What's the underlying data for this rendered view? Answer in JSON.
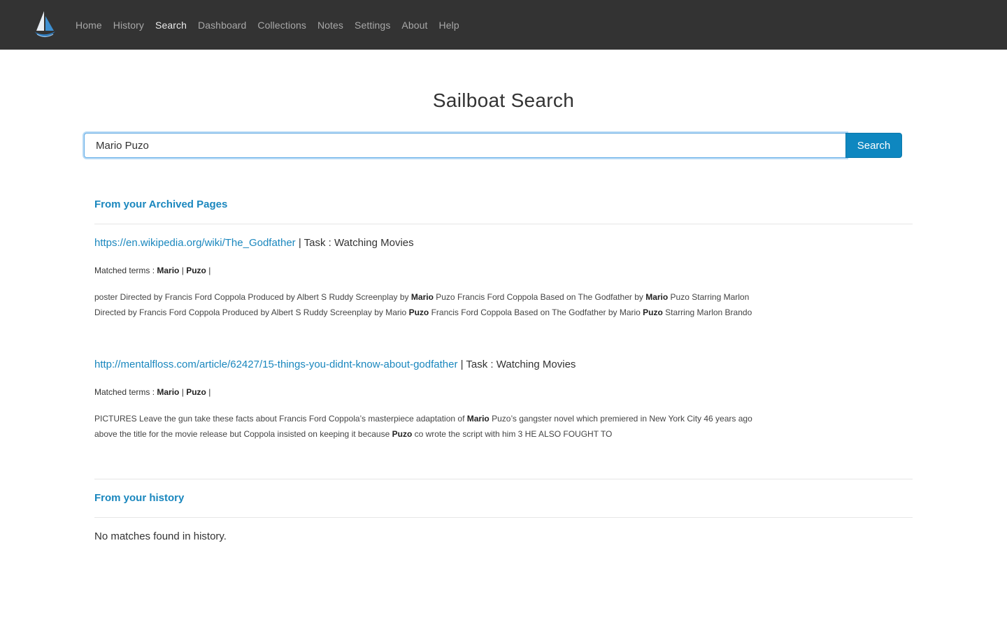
{
  "navbar": {
    "logo_icon": "sailboat-logo-icon",
    "items": [
      {
        "label": "Home",
        "active": false
      },
      {
        "label": "History",
        "active": false
      },
      {
        "label": "Search",
        "active": true
      },
      {
        "label": "Dashboard",
        "active": false
      },
      {
        "label": "Collections",
        "active": false
      },
      {
        "label": "Notes",
        "active": false
      },
      {
        "label": "Settings",
        "active": false
      },
      {
        "label": "About",
        "active": false
      },
      {
        "label": "Help",
        "active": false
      }
    ]
  },
  "page": {
    "title": "Sailboat Search"
  },
  "search": {
    "value": "Mario Puzo",
    "button_label": "Search"
  },
  "archived": {
    "heading": "From your Archived Pages",
    "matched_prefix": "Matched terms : ",
    "task_prefix": " | Task : ",
    "results": [
      {
        "url": "https://en.wikipedia.org/wiki/The_Godfather",
        "task": "Watching Movies",
        "terms": [
          "Mario",
          "Puzo"
        ],
        "snippet_lines": [
          [
            {
              "t": "poster Directed by Francis Ford Coppola Produced by Albert S Ruddy Screenplay by ",
              "b": false
            },
            {
              "t": "Mario",
              "b": true
            },
            {
              "t": " Puzo Francis Ford Coppola Based on The Godfather by ",
              "b": false
            },
            {
              "t": "Mario",
              "b": true
            },
            {
              "t": " Puzo Starring Marlon",
              "b": false
            }
          ],
          [
            {
              "t": "Directed by Francis Ford Coppola Produced by Albert S Ruddy Screenplay by Mario ",
              "b": false
            },
            {
              "t": "Puzo",
              "b": true
            },
            {
              "t": " Francis Ford Coppola Based on The Godfather by Mario ",
              "b": false
            },
            {
              "t": "Puzo",
              "b": true
            },
            {
              "t": " Starring Marlon Brando",
              "b": false
            }
          ]
        ]
      },
      {
        "url": "http://mentalfloss.com/article/62427/15-things-you-didnt-know-about-godfather",
        "task": "Watching Movies",
        "terms": [
          "Mario",
          "Puzo"
        ],
        "snippet_lines": [
          [
            {
              "t": "PICTURES Leave the gun take these facts about Francis Ford Coppola’s masterpiece adaptation of ",
              "b": false
            },
            {
              "t": "Mario",
              "b": true
            },
            {
              "t": " Puzo’s gangster novel which premiered in New York City 46 years ago",
              "b": false
            }
          ],
          [
            {
              "t": "above the title for the movie release but Coppola insisted on keeping it because ",
              "b": false
            },
            {
              "t": "Puzo",
              "b": true
            },
            {
              "t": " co wrote the script with him 3 HE ALSO FOUGHT TO",
              "b": false
            }
          ]
        ]
      }
    ]
  },
  "history": {
    "heading": "From your history",
    "empty_message": "No matches found in history."
  },
  "colors": {
    "navbar_bg": "#333333",
    "accent": "#1a87be",
    "button_bg": "#0e87c0"
  }
}
